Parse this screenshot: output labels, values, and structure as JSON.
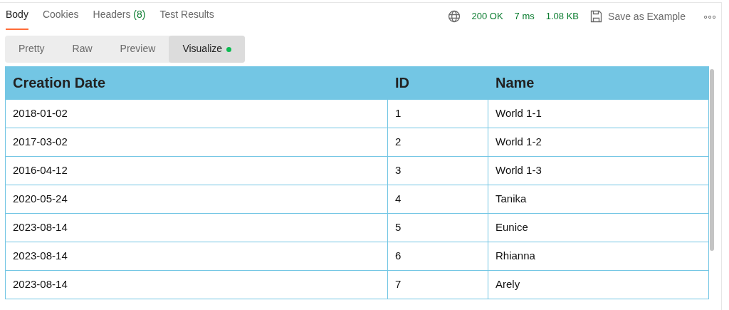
{
  "tabs": [
    {
      "label": "Body",
      "selected": true
    },
    {
      "label": "Cookies",
      "selected": false
    },
    {
      "label": "Headers",
      "count": "(8)",
      "selected": false
    },
    {
      "label": "Test Results",
      "selected": false
    }
  ],
  "status": {
    "code": "200 OK",
    "time": "7 ms",
    "size": "1.08 KB"
  },
  "save_label": "Save as Example",
  "more": "∘∘∘",
  "view_modes": [
    {
      "label": "Pretty",
      "selected": false,
      "dot": false
    },
    {
      "label": "Raw",
      "selected": false,
      "dot": false
    },
    {
      "label": "Preview",
      "selected": false,
      "dot": false
    },
    {
      "label": "Visualize",
      "selected": true,
      "dot": true
    }
  ],
  "table": {
    "columns": [
      "Creation Date",
      "ID",
      "Name"
    ],
    "rows": [
      [
        "2018-01-02",
        "1",
        "World 1-1"
      ],
      [
        "2017-03-02",
        "2",
        "World 1-2"
      ],
      [
        "2016-04-12",
        "3",
        "World 1-3"
      ],
      [
        "2020-05-24",
        "4",
        "Tanika"
      ],
      [
        "2023-08-14",
        "5",
        "Eunice"
      ],
      [
        "2023-08-14",
        "6",
        "Rhianna"
      ],
      [
        "2023-08-14",
        "7",
        "Arely"
      ]
    ]
  }
}
